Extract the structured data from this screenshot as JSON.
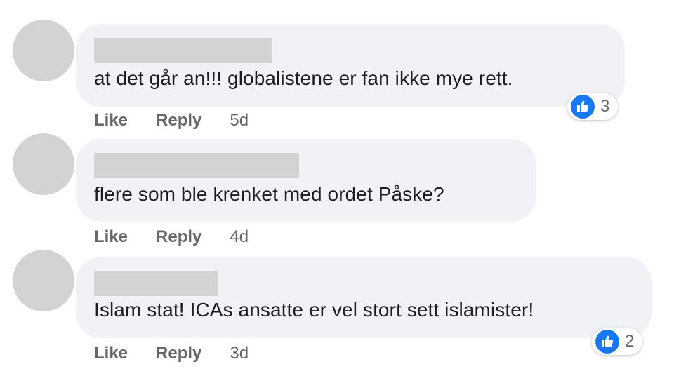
{
  "comments": [
    {
      "text": "at det går an!!! globalistene er fan ikke mye rett.",
      "actions": {
        "like": "Like",
        "reply": "Reply"
      },
      "time": "5d",
      "reactions": {
        "icon": "thumbs-up-icon",
        "count": "3"
      }
    },
    {
      "text": "flere som ble krenket med ordet Påske?",
      "actions": {
        "like": "Like",
        "reply": "Reply"
      },
      "time": "4d"
    },
    {
      "text": "Islam stat! ICAs ansatte er vel stort sett islamister!",
      "actions": {
        "like": "Like",
        "reply": "Reply"
      },
      "time": "3d",
      "reactions": {
        "icon": "thumbs-up-icon",
        "count": "2"
      }
    }
  ],
  "colors": {
    "bubble": "#f0f2f5",
    "redaction": "#d3d3d3",
    "like_blue": "#1877f2",
    "text": "#1c1e21",
    "muted": "#65676b"
  }
}
